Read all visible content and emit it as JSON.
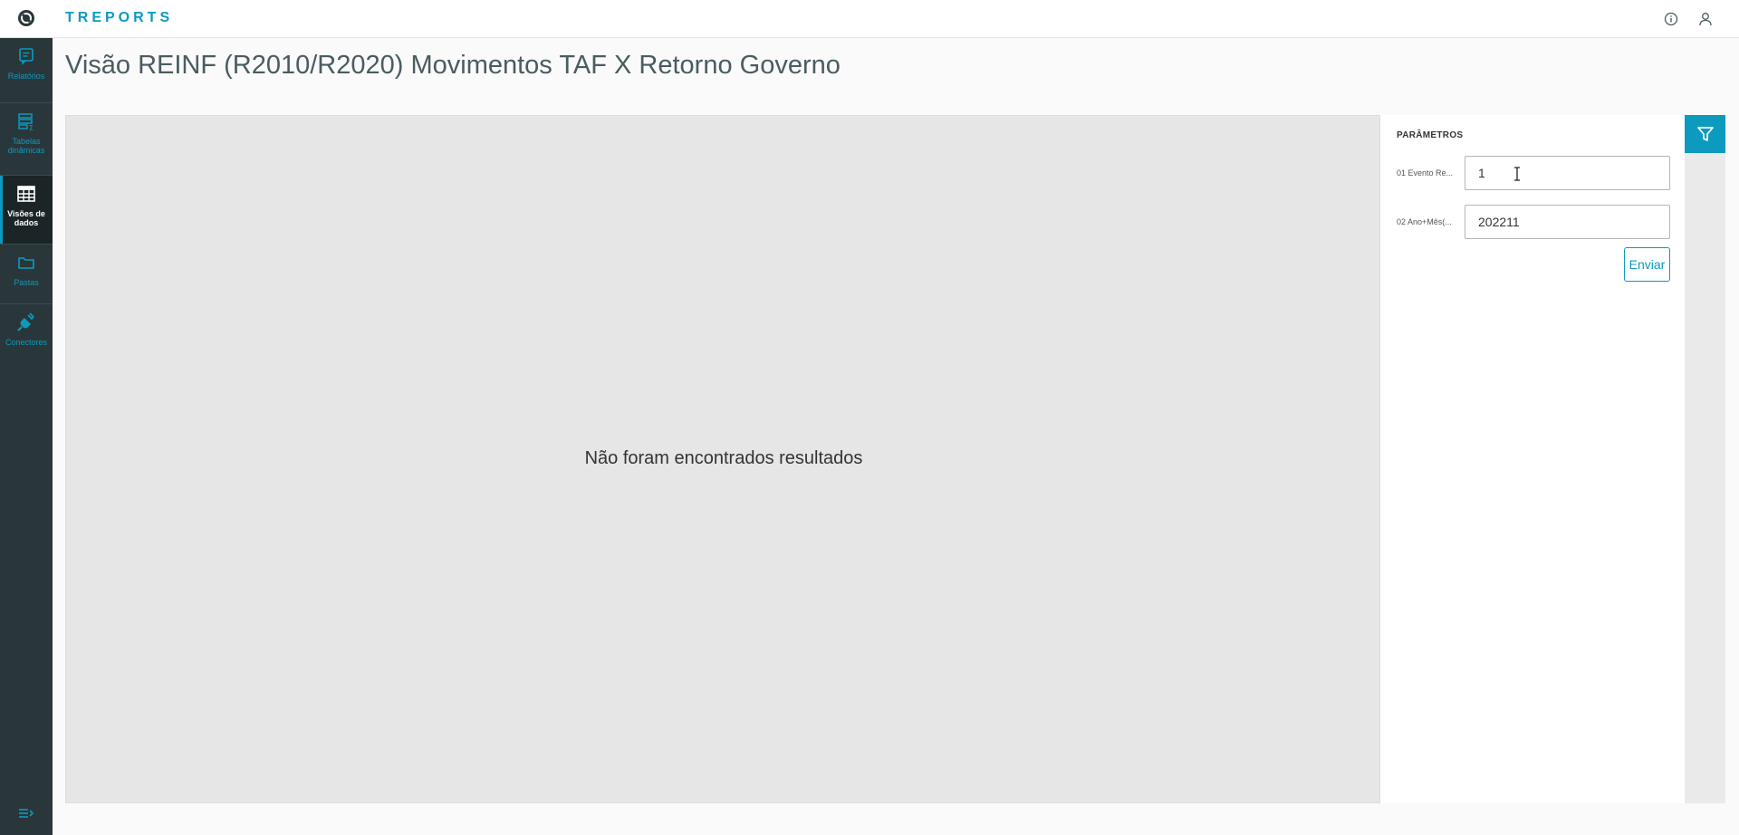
{
  "app": {
    "brand": "TREPORTS"
  },
  "sidebar": {
    "items": [
      {
        "label": "Relatórios",
        "icon": "report-icon"
      },
      {
        "label": "Tabelas dinâmicas",
        "icon": "pivot-table-icon"
      },
      {
        "label": "Visões de dados",
        "icon": "grid-icon",
        "active": true
      },
      {
        "label": "Pastas",
        "icon": "folder-icon"
      },
      {
        "label": "Conectores",
        "icon": "plug-icon"
      }
    ]
  },
  "page": {
    "title": "Visão REINF (R2010/R2020) Movimentos TAF X Retorno Governo"
  },
  "results": {
    "empty_message": "Não foram encontrados resultados"
  },
  "params": {
    "title": "PARÂMETROS",
    "fields": [
      {
        "label": "01 Evento Re...",
        "value": "1"
      },
      {
        "label": "02 Ano+Mês(...",
        "value": "202211"
      }
    ],
    "submit_label": "Enviar"
  },
  "colors": {
    "accent": "#0c9abe",
    "sidebar_bg": "#29373a",
    "sidebar_active": "#1b2426",
    "results_bg": "#e6e6e6"
  }
}
